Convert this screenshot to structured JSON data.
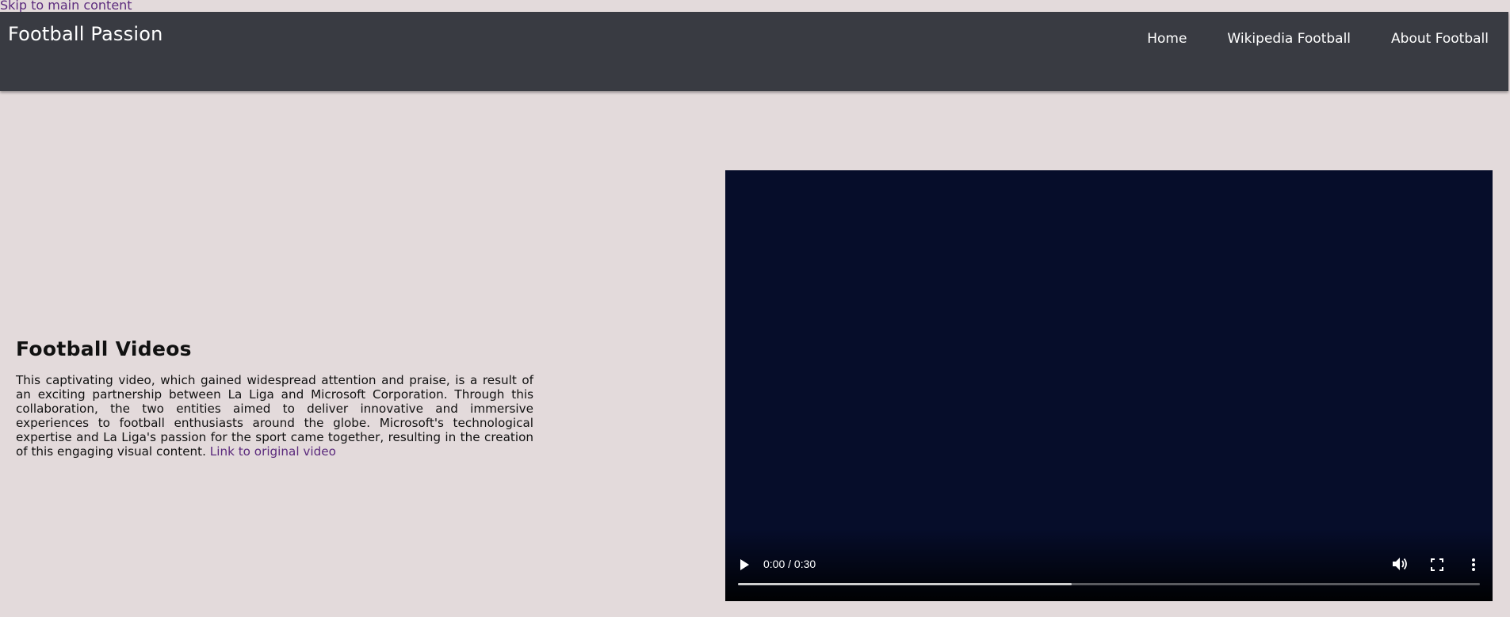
{
  "skip_link": "Skip to main content",
  "header": {
    "brand": "Football Passion",
    "nav": [
      {
        "label": "Home"
      },
      {
        "label": "Wikipedia Football"
      },
      {
        "label": "About Football"
      }
    ]
  },
  "main": {
    "title": "Football Videos",
    "body": "This captivating video, which gained widespread attention and praise, is a result of an exciting partnership between La Liga and Microsoft Corporation. Through this collaboration, the two entities aimed to deliver innovative and immersive experiences to football enthusiasts around the globe. Microsoft's technological expertise and La Liga's passion for the sport came together, resulting in the creation of this engaging visual content.",
    "link_label": "Link to original video"
  },
  "video": {
    "time": "0:00 / 0:30",
    "buffered_percent": 45,
    "icons": {
      "play": "play-icon",
      "volume": "volume-icon",
      "fullscreen": "fullscreen-icon",
      "more": "more-vertical-icon"
    }
  },
  "colors": {
    "page_background": "#e3dadb",
    "header_background": "#393b42",
    "link": "#5b2a7d",
    "video_background": "#060d2a"
  }
}
